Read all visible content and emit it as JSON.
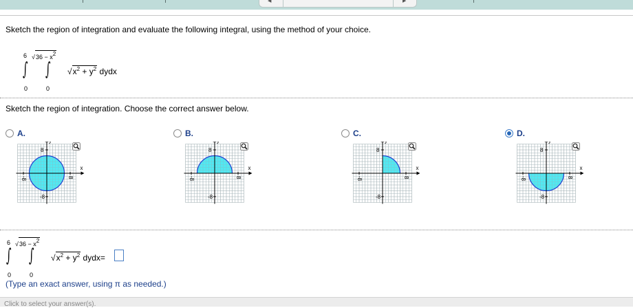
{
  "nav": {
    "left_arrow": "◀",
    "right_arrow": "▶"
  },
  "question": {
    "instructions": "Sketch the region of integration and evaluate the following integral, using the method of your choice.",
    "integral": {
      "outer_upper": "6",
      "outer_lower": "0",
      "inner_upper": "√36 − x²",
      "inner_upper_base": "36 − x",
      "inner_upper_exp": "2",
      "inner_lower": "0",
      "integrand_x": "x",
      "integrand_y": "y",
      "exp": "2",
      "plus": " + ",
      "differentials": "dydx"
    }
  },
  "part1": {
    "prompt": "Sketch the region of integration. Choose the correct answer below.",
    "options": [
      {
        "label": "A.",
        "region": "full-disk",
        "selected": false
      },
      {
        "label": "B.",
        "region": "upper-half",
        "selected": false
      },
      {
        "label": "C.",
        "region": "first-quadrant",
        "selected": false
      },
      {
        "label": "D.",
        "region": "lower-half",
        "selected": true
      }
    ],
    "axis": {
      "x_label": "x",
      "y_label": "y",
      "tick_pos": "8",
      "tick_neg": "-8"
    }
  },
  "part2": {
    "equals": "=",
    "hint": "(Type an exact answer, using π as needed.)",
    "answer_value": ""
  },
  "footer": {
    "status": "Click to select your answer(s)."
  },
  "colors": {
    "fill": "#33e5f0",
    "circle": "#1f3fd1",
    "grid": "#bdbdbd",
    "option_label": "#1c3f8a"
  }
}
